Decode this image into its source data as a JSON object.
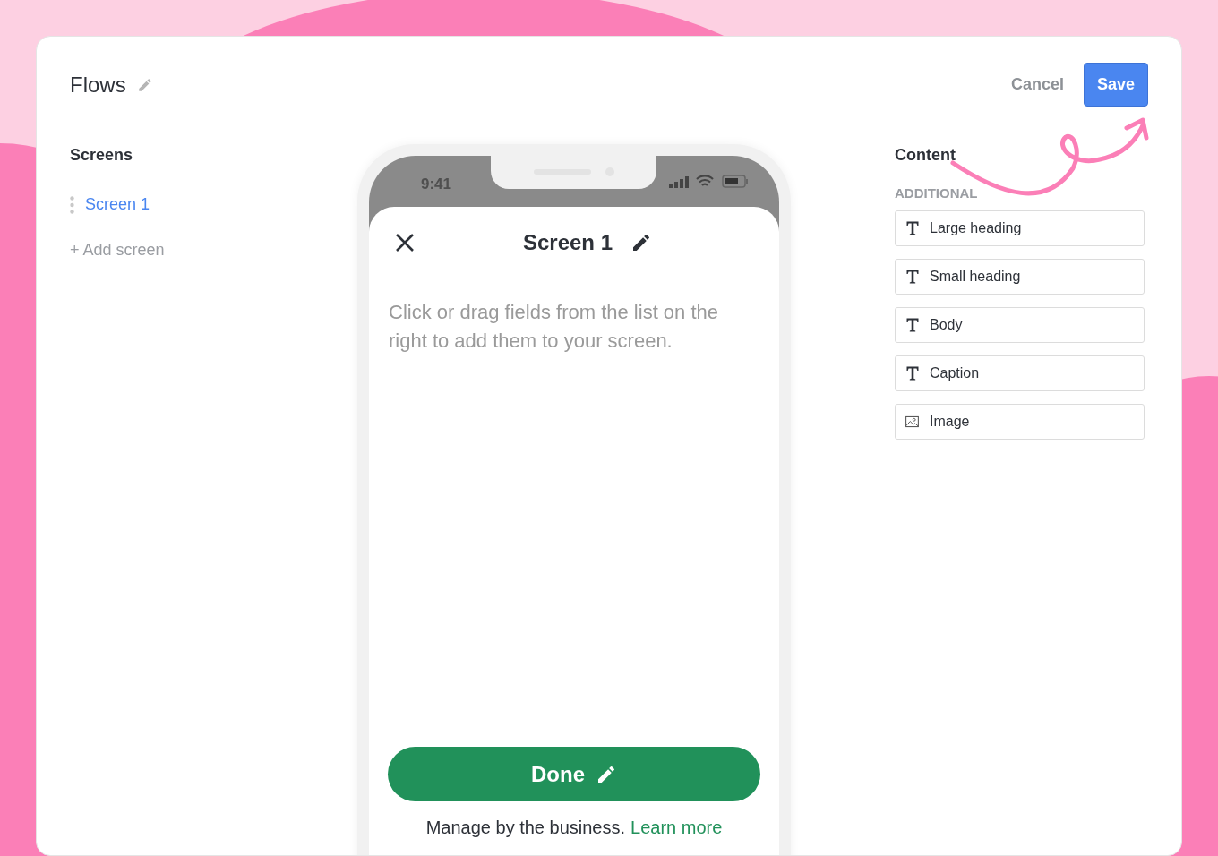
{
  "header": {
    "title": "Flows",
    "cancel": "Cancel",
    "save": "Save"
  },
  "screens": {
    "heading": "Screens",
    "items": [
      {
        "label": "Screen 1",
        "selected": true
      }
    ],
    "add": "+ Add screen"
  },
  "phone": {
    "time": "9:41",
    "title": "Screen 1",
    "hint": "Click or drag fields from the list on the right to add them to your screen.",
    "done": "Done",
    "footer": "Manage by the business.",
    "link": "Learn more"
  },
  "content": {
    "heading": "Content",
    "section": "ADDITIONAL",
    "fields": [
      {
        "label": "Large heading",
        "kind": "text"
      },
      {
        "label": "Small heading",
        "kind": "text"
      },
      {
        "label": "Body",
        "kind": "text"
      },
      {
        "label": "Caption",
        "kind": "text"
      },
      {
        "label": "Image",
        "kind": "image"
      }
    ]
  }
}
